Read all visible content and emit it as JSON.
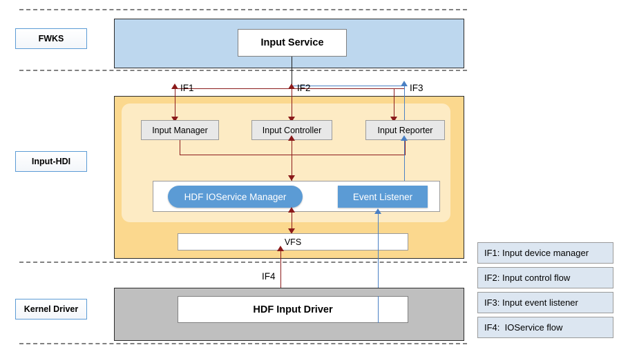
{
  "diagram": {
    "layers": [
      {
        "id": "fwks",
        "label": "FWKS"
      },
      {
        "id": "hdi",
        "label": "Input-HDI"
      },
      {
        "id": "kernel",
        "label": "Kernel Driver"
      }
    ],
    "fwks": {
      "service_box": "Input Service"
    },
    "hdi": {
      "modules": [
        {
          "label": "Input Manager"
        },
        {
          "label": "Input Controller"
        },
        {
          "label": "Input Reporter"
        }
      ],
      "service_blocks": [
        {
          "label": "HDF IOService Manager",
          "shape": "pill"
        },
        {
          "label": "Event Listener",
          "shape": "rect"
        }
      ],
      "vfs": "VFS"
    },
    "kernel": {
      "driver_box": "HDF Input Driver"
    },
    "interfaces": [
      {
        "id": "IF1",
        "label": "IF1",
        "color": "#8B1A1A"
      },
      {
        "id": "IF2",
        "label": "IF2",
        "color": "#8B1A1A"
      },
      {
        "id": "IF3",
        "label": "IF3",
        "color": "#4A80C4"
      },
      {
        "id": "IF4",
        "label": "IF4",
        "color": "#8B1A1A"
      }
    ],
    "legend": [
      {
        "text": "IF1: Input device manager"
      },
      {
        "text": "IF2: Input control flow"
      },
      {
        "text": "IF3: Input event listener"
      },
      {
        "text": "IF4:  IOService flow"
      }
    ],
    "colors": {
      "fwks_fill": "#BDD7EE",
      "hdi_fill": "#FBD88E",
      "hdi_inner_fill": "#FDEBC4",
      "kernel_fill": "#BFBFBF",
      "accent_blue": "#5B9BD5",
      "arrow_red": "#8B1A1A",
      "arrow_blue": "#4A80C4",
      "legend_fill": "#DCE6F1",
      "tag_border": "#5B9BD5"
    }
  }
}
